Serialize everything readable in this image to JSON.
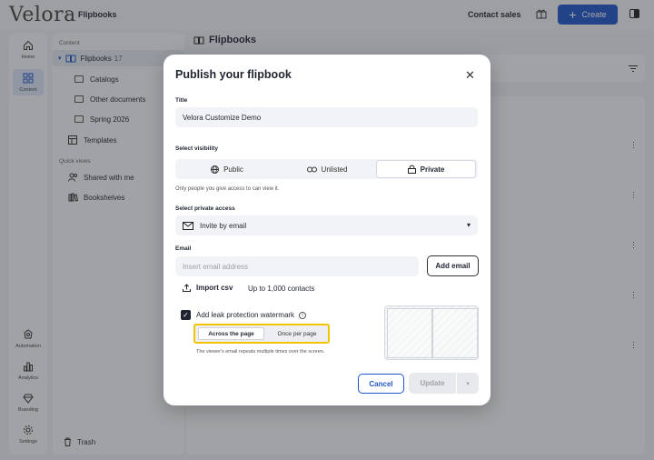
{
  "app": {
    "logo": "Velora",
    "breadcrumb": "Flipbooks"
  },
  "topbar": {
    "contact_sales": "Contact sales",
    "create_label": "Create",
    "accent": "#1e55c8"
  },
  "nav": [
    {
      "label": "Home",
      "icon": "home-icon"
    },
    {
      "label": "Content",
      "icon": "grid-icon",
      "active": true
    },
    {
      "label": "Automation",
      "icon": "automation-icon"
    },
    {
      "label": "Analytics",
      "icon": "analytics-icon"
    },
    {
      "label": "Branding",
      "icon": "diamond-icon"
    },
    {
      "label": "Settings",
      "icon": "gear-icon"
    }
  ],
  "sidebar": {
    "content_label": "Content",
    "flipbooks": {
      "label": "Flipbooks",
      "count": "17"
    },
    "folders": [
      "Catalogs",
      "Other documents",
      "Spring 2026"
    ],
    "templates": "Templates",
    "quick_views_label": "Quick views",
    "shared": "Shared with me",
    "bookshelves": "Bookshelves",
    "trash": "Trash"
  },
  "main": {
    "title": "Flipbooks"
  },
  "modal": {
    "title": "Publish your flipbook",
    "title_label": "Title",
    "title_value": "Velora Customize Demo",
    "visibility_label": "Select visibility",
    "visibility_options": [
      "Public",
      "Unlisted",
      "Private"
    ],
    "visibility_selected": "Private",
    "visibility_hint": "Only people you give access to can view it.",
    "access_label": "Select private access",
    "access_value": "Invite by email",
    "email_label": "Email",
    "email_placeholder": "Insert email address",
    "add_email": "Add email",
    "import_csv": "Import csv",
    "contacts_limit": "Up to 1,000 contacts",
    "watermark_label": "Add leak protection watermark",
    "watermark_checked": true,
    "watermark_options": [
      "Across the page",
      "Once per page"
    ],
    "watermark_selected": "Across the page",
    "watermark_hint": "The viewer's email repeats multiple times over the screen.",
    "highlight_color": "#f2c500",
    "cancel": "Cancel",
    "update": "Update"
  }
}
